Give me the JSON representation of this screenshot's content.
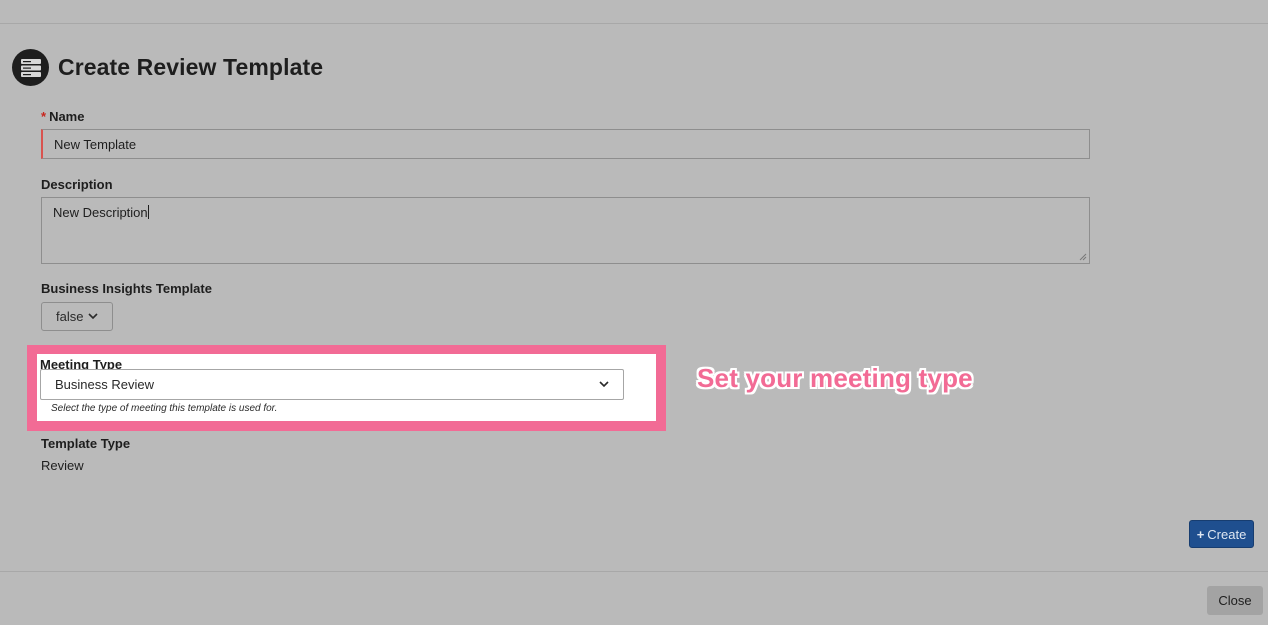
{
  "header": {
    "title": "Create Review Template",
    "icon": "server-stack-icon"
  },
  "form": {
    "name": {
      "required_marker": "*",
      "label": "Name",
      "value": "New Template"
    },
    "description": {
      "label": "Description",
      "value": "New Description"
    },
    "business_insights": {
      "label": "Business Insights Template",
      "value": "false"
    },
    "meeting_type": {
      "label": "Meeting Type",
      "value": "Business Review",
      "help": "Select the type of meeting this template is used for."
    },
    "template_type": {
      "label": "Template Type",
      "value": "Review"
    }
  },
  "callout": {
    "text": "Set your meeting type",
    "color": "#f26b95"
  },
  "buttons": {
    "create_label": "Create",
    "create_icon": "+",
    "close_label": "Close"
  },
  "colors": {
    "primary": "#1f4f8f",
    "highlight": "#f26b95",
    "required": "#c8261e"
  }
}
